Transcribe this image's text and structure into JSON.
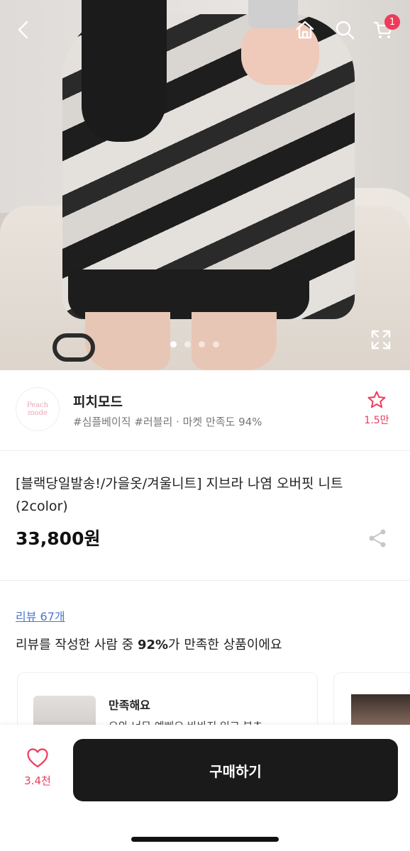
{
  "header": {
    "cart_badge": "1"
  },
  "icons": {
    "back": "chevron-left-icon",
    "home": "home-icon",
    "search": "search-icon",
    "cart": "cart-icon",
    "expand": "expand-icon",
    "star": "star-icon",
    "share": "share-icon",
    "heart": "heart-icon"
  },
  "gallery": {
    "total_dots": 4,
    "active_index": 0
  },
  "shop": {
    "logo_text": "Peach mode",
    "name": "피치모드",
    "tags": "#심플베이직 #러블리 · 마켓 만족도 94%",
    "fav_count": "1.5만"
  },
  "product": {
    "title": "[블랙당일발송!/가을옷/겨울니트] 지브라 나염 오버핏 니트 (2color)",
    "price": "33,800원"
  },
  "reviews": {
    "link": "리뷰 67개",
    "summary_prefix": "리뷰를 작성한 사람 중 ",
    "summary_percent": "92%",
    "summary_suffix": "가 만족한 상품이에요",
    "card_title": "만족해요",
    "card_body": "오와 너무 예뻐요 바바지 입고 부츠"
  },
  "bottom": {
    "like_count": "3.4천",
    "buy_label": "구매하기"
  },
  "colors": {
    "accent": "#ef3b5a",
    "link": "#4b77c9",
    "buy_button": "#1a1a1a"
  }
}
